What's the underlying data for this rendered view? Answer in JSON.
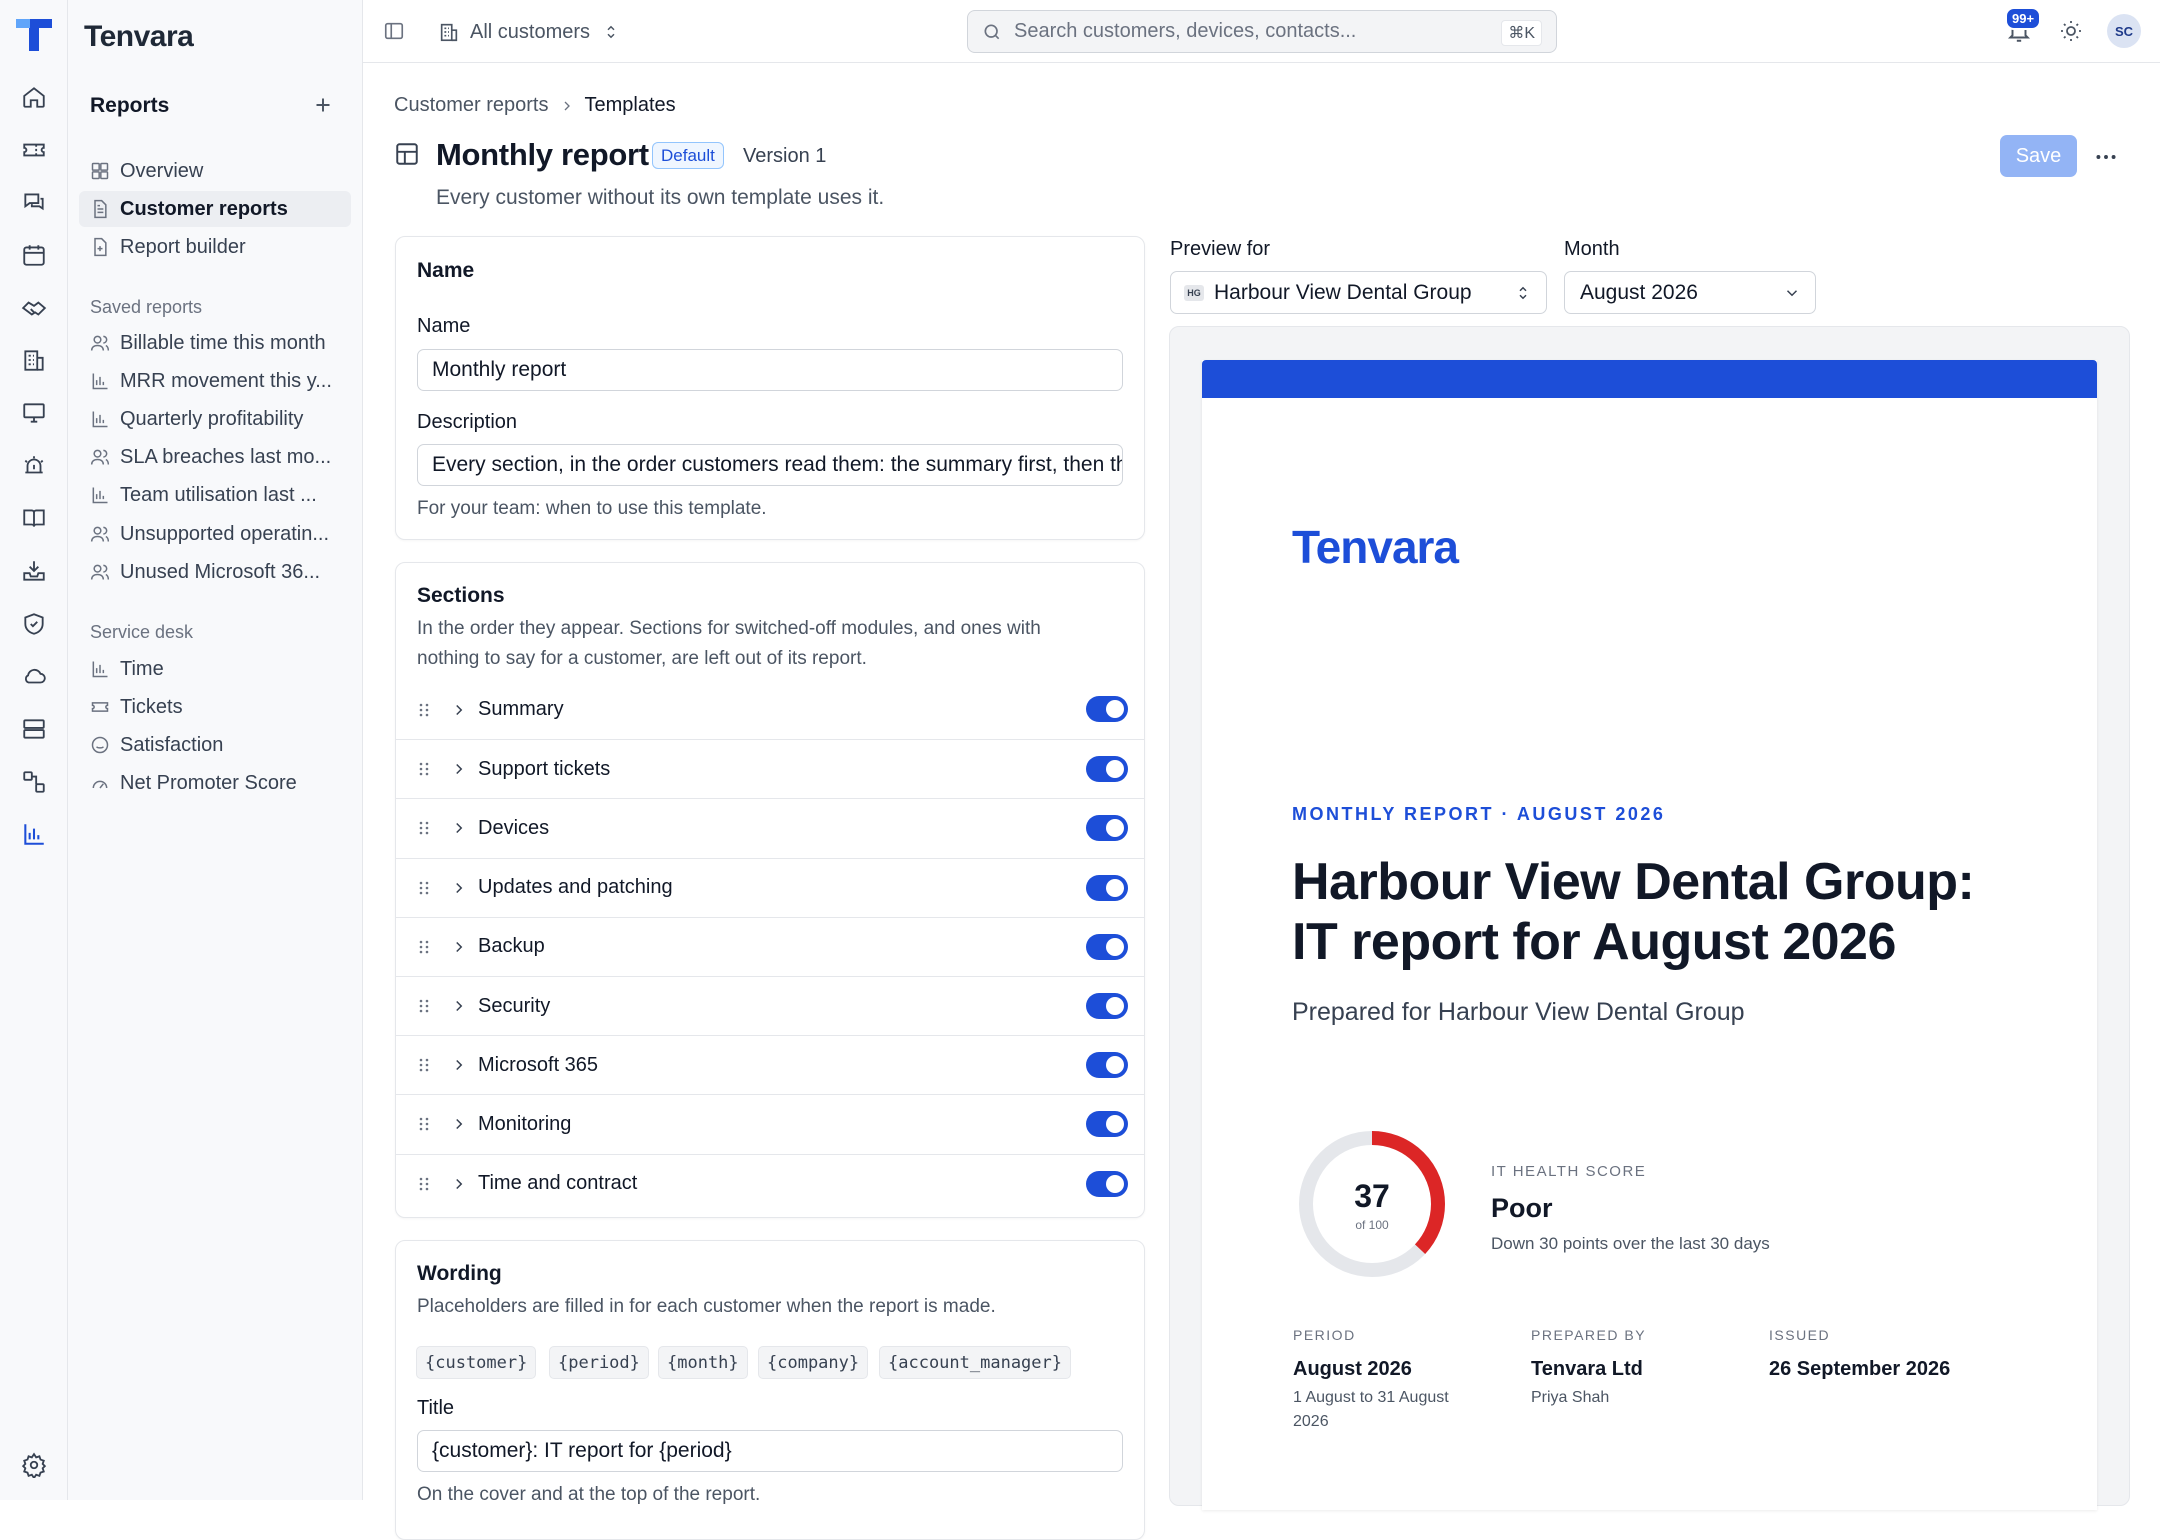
{
  "app": {
    "name": "Tenvara"
  },
  "rail": {
    "items": [
      "tenvara-logo",
      "home-icon",
      "ticket-icon",
      "chat-icon",
      "calendar-icon",
      "handshake-icon",
      "building-icon",
      "monitor-icon",
      "alarm-icon",
      "book-icon",
      "inbox-download-icon",
      "shield-icon",
      "cloud-icon",
      "server-icon",
      "workflow-icon",
      "bar-chart-icon",
      "settings-icon"
    ]
  },
  "sidebar": {
    "title": "Reports",
    "nav": [
      {
        "label": "Overview",
        "icon": "dashboard-icon"
      },
      {
        "label": "Customer reports",
        "icon": "document-icon",
        "active": true
      },
      {
        "label": "Report builder",
        "icon": "document-plus-icon"
      }
    ],
    "saved_title": "Saved reports",
    "saved": [
      {
        "label": "Billable time this month",
        "icon": "users-icon"
      },
      {
        "label": "MRR movement this y...",
        "icon": "bar-chart-icon"
      },
      {
        "label": "Quarterly profitability",
        "icon": "bar-chart-icon"
      },
      {
        "label": "SLA breaches last mo...",
        "icon": "users-icon"
      },
      {
        "label": "Team utilisation last ...",
        "icon": "bar-chart-icon"
      },
      {
        "label": "Unsupported operatin...",
        "icon": "users-icon"
      },
      {
        "label": "Unused Microsoft 36...",
        "icon": "users-icon"
      }
    ],
    "desk_title": "Service desk",
    "desk": [
      {
        "label": "Time",
        "icon": "bar-chart-icon"
      },
      {
        "label": "Tickets",
        "icon": "ticket-icon"
      },
      {
        "label": "Satisfaction",
        "icon": "smile-icon"
      },
      {
        "label": "Net Promoter Score",
        "icon": "gauge-icon"
      }
    ]
  },
  "topbar": {
    "customer_scope": "All customers",
    "search_placeholder": "Search customers, devices, contacts...",
    "search_shortcut": "⌘K",
    "notifications_count": "99+",
    "avatar_initials": "SC"
  },
  "breadcrumb": {
    "parent": "Customer reports",
    "current": "Templates"
  },
  "header": {
    "title": "Monthly report",
    "badge": "Default",
    "version": "Version 1",
    "subtitle": "Every customer without its own template uses it.",
    "save_label": "Save"
  },
  "name_card": {
    "heading": "Name",
    "name_label": "Name",
    "name_value": "Monthly report",
    "desc_label": "Description",
    "desc_value": "Every section, in the order customers read them: the summary first, then the detail",
    "desc_help": "For your team: when to use this template."
  },
  "sections_card": {
    "heading": "Sections",
    "help_line1": "In the order they appear. Sections for switched-off modules, and ones with",
    "help_line2": "nothing to say for a customer, are left out of its report.",
    "items": [
      {
        "label": "Summary",
        "enabled": true
      },
      {
        "label": "Support tickets",
        "enabled": true
      },
      {
        "label": "Devices",
        "enabled": true
      },
      {
        "label": "Updates and patching",
        "enabled": true
      },
      {
        "label": "Backup",
        "enabled": true
      },
      {
        "label": "Security",
        "enabled": true
      },
      {
        "label": "Microsoft 365",
        "enabled": true
      },
      {
        "label": "Monitoring",
        "enabled": true
      },
      {
        "label": "Time and contract",
        "enabled": true
      }
    ]
  },
  "wording_card": {
    "heading": "Wording",
    "help": "Placeholders are filled in for each customer when the report is made.",
    "placeholders": [
      "{customer}",
      "{period}",
      "{month}",
      "{company}",
      "{account_manager}"
    ],
    "title_label": "Title",
    "title_value": "{customer}: IT report for {period}",
    "title_help": "On the cover and at the top of the report."
  },
  "preview": {
    "for_label": "Preview for",
    "for_value": "Harbour View Dental Group",
    "for_chip": "HG",
    "month_label": "Month",
    "month_value": "August 2026"
  },
  "report": {
    "brand": "Tenvara",
    "accent": "#1d4ed8",
    "eyebrow": "MONTHLY REPORT · AUGUST 2026",
    "title_line1": "Harbour View Dental Group:",
    "title_line2": "IT report for August 2026",
    "prepared_for": "Prepared for Harbour View Dental Group",
    "health": {
      "score": "37",
      "of": "of 100",
      "score_fraction": 0.37,
      "score_color": "#dc2626",
      "label": "IT HEALTH SCORE",
      "rating": "Poor",
      "note": "Down 30 points over the last 30 days"
    },
    "meta": [
      {
        "label": "PERIOD",
        "value": "August 2026",
        "sub": "1 August to 31 August 2026"
      },
      {
        "label": "PREPARED BY",
        "value": "Tenvara Ltd",
        "sub": "Priya Shah"
      },
      {
        "label": "ISSUED",
        "value": "26 September 2026",
        "sub": ""
      }
    ]
  }
}
